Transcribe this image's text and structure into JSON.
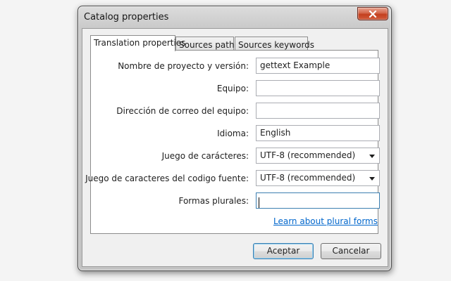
{
  "window": {
    "title": "Catalog properties"
  },
  "tabs": [
    {
      "label": "Translation properties",
      "active": true
    },
    {
      "label": "Sources paths",
      "active": false
    },
    {
      "label": "Sources keywords",
      "active": false
    }
  ],
  "form": {
    "project": {
      "label": "Nombre de proyecto y versión:",
      "value": "gettext Example"
    },
    "team": {
      "label": "Equipo:",
      "value": ""
    },
    "team_email": {
      "label": "Dirección de correo del equipo:",
      "value": ""
    },
    "language": {
      "label": "Idioma:",
      "value": "English"
    },
    "charset": {
      "label": "Juego de carácteres:",
      "value": "UTF-8 (recommended)"
    },
    "source_charset": {
      "label": "Juego de caracteres del codigo fuente:",
      "value": "UTF-8 (recommended)"
    },
    "plural_forms": {
      "label": "Formas plurales:",
      "value": ""
    }
  },
  "plural_link": "Learn about plural forms",
  "buttons": {
    "accept": "Aceptar",
    "cancel": "Cancelar"
  },
  "colors": {
    "link": "#0066cc",
    "close_button": "#c4401f",
    "focus_border": "#3c7fb1"
  }
}
